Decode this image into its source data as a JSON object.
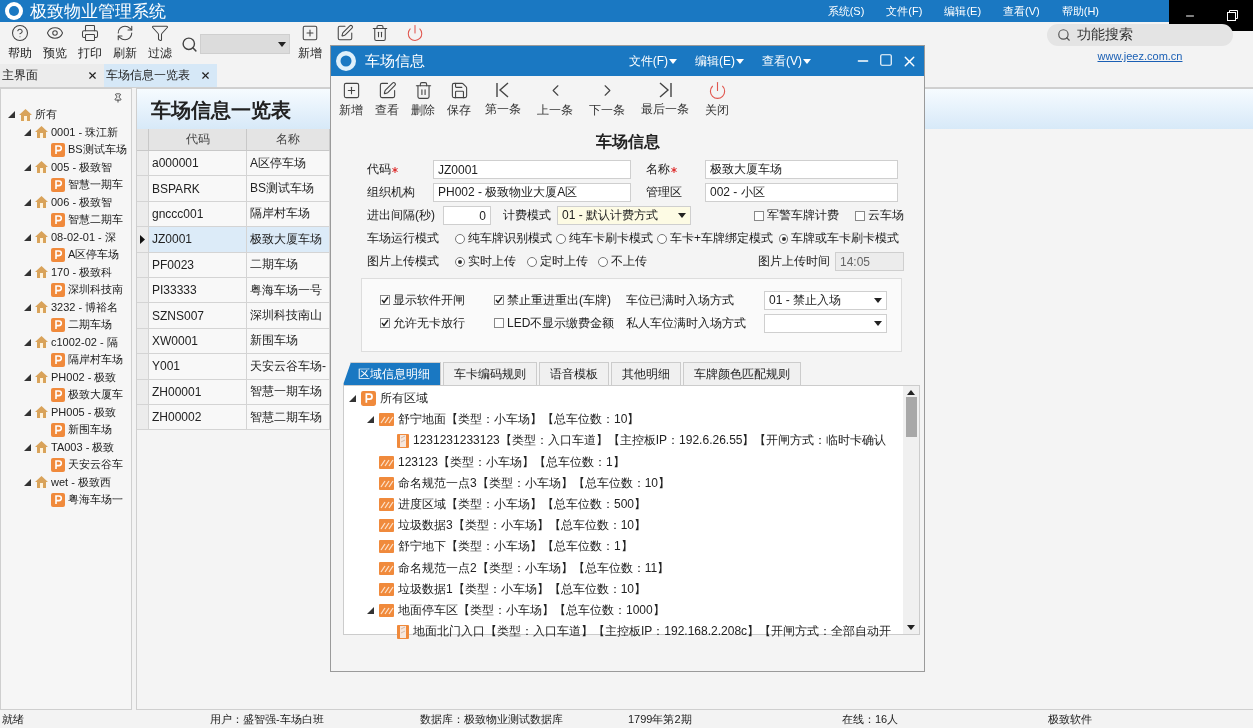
{
  "app": {
    "title": "极致物业管理系统",
    "menu": [
      "系统(S)",
      "文件(F)",
      "编辑(E)",
      "查看(V)",
      "帮助(H)"
    ]
  },
  "toolbar": {
    "left": [
      {
        "kind": "help",
        "label": "帮助"
      },
      {
        "kind": "preview",
        "label": "预览"
      },
      {
        "kind": "print",
        "label": "打印"
      },
      {
        "kind": "refresh",
        "label": "刷新"
      },
      {
        "kind": "filter",
        "label": "过滤"
      }
    ],
    "right": [
      {
        "kind": "add",
        "label": "新增"
      },
      {
        "kind": "edit"
      },
      {
        "kind": "delete"
      },
      {
        "kind": "power"
      }
    ]
  },
  "feature_search": {
    "placeholder": "功能搜索"
  },
  "website": "www.jeez.com.cn",
  "doc_tabs": [
    {
      "label": "主界面",
      "selected": false
    },
    {
      "label": "车场信息一览表",
      "selected": true
    }
  ],
  "org_tree": {
    "label": "所有",
    "expanded": true,
    "children": [
      {
        "label": "0001 - 珠江新",
        "expanded": true,
        "children": [
          {
            "label": "BS测试车场"
          }
        ]
      },
      {
        "label": "005 - 极致智",
        "expanded": true,
        "children": [
          {
            "label": "智慧一期车"
          }
        ]
      },
      {
        "label": "006 - 极致智",
        "expanded": true,
        "children": [
          {
            "label": "智慧二期车"
          }
        ]
      },
      {
        "label": "08-02-01 - 深",
        "expanded": true,
        "children": [
          {
            "label": "A区停车场"
          }
        ]
      },
      {
        "label": "170 - 极致科",
        "expanded": true,
        "children": [
          {
            "label": "深圳科技南"
          }
        ]
      },
      {
        "label": "3232 - 博裕名",
        "expanded": true,
        "children": [
          {
            "label": "二期车场"
          }
        ]
      },
      {
        "label": "c1002-02 - 隔",
        "expanded": true,
        "children": [
          {
            "label": "隔岸村车场"
          }
        ]
      },
      {
        "label": "PH002 - 极致",
        "expanded": true,
        "children": [
          {
            "label": "极致大厦车"
          }
        ]
      },
      {
        "label": "PH005 - 极致",
        "expanded": true,
        "children": [
          {
            "label": "新围车场"
          }
        ]
      },
      {
        "label": "TA003 - 极致",
        "expanded": true,
        "children": [
          {
            "label": "天安云谷车"
          }
        ]
      },
      {
        "label": "wet - 极致西",
        "expanded": true,
        "children": [
          {
            "label": "粤海车场一"
          }
        ]
      }
    ]
  },
  "list": {
    "title": "车场信息一览表",
    "columns": [
      "代码",
      "名称"
    ],
    "rows": [
      {
        "cells": [
          "a000001",
          "A区停车场"
        ],
        "selected": false
      },
      {
        "cells": [
          "BSPARK",
          "BS测试车场"
        ],
        "selected": false
      },
      {
        "cells": [
          "gnccc001",
          "隔岸村车场"
        ],
        "selected": false
      },
      {
        "cells": [
          "JZ0001",
          "极致大厦车场"
        ],
        "selected": true
      },
      {
        "cells": [
          "PF0023",
          "二期车场"
        ],
        "selected": false
      },
      {
        "cells": [
          "PI33333",
          "粤海车场一号"
        ],
        "selected": false
      },
      {
        "cells": [
          "SZNS007",
          "深圳科技南山"
        ],
        "selected": false
      },
      {
        "cells": [
          "XW0001",
          "新围车场"
        ],
        "selected": false
      },
      {
        "cells": [
          "Y001",
          "天安云谷车场-"
        ],
        "selected": false
      },
      {
        "cells": [
          "ZH00001",
          "智慧一期车场"
        ],
        "selected": false
      },
      {
        "cells": [
          "ZH00002",
          "智慧二期车场"
        ],
        "selected": false
      }
    ]
  },
  "dialog": {
    "title": "车场信息",
    "menu": [
      "文件(F)",
      "编辑(E)",
      "查看(V)"
    ],
    "toolbar": [
      {
        "kind": "add",
        "label": "新增"
      },
      {
        "kind": "edit",
        "label": "查看"
      },
      {
        "kind": "delete",
        "label": "删除"
      },
      {
        "kind": "save",
        "label": "保存"
      },
      {
        "kind": "first",
        "label": "第一条"
      },
      {
        "kind": "prev",
        "label": "上一条"
      },
      {
        "kind": "next",
        "label": "下一条"
      },
      {
        "kind": "last",
        "label": "最后一条"
      },
      {
        "kind": "close",
        "label": "关闭"
      }
    ],
    "form_title": "车场信息",
    "code": {
      "label": "代码",
      "required": true,
      "value": "JZ0001"
    },
    "name": {
      "label": "名称",
      "required": true,
      "value": "极致大厦车场"
    },
    "org": {
      "label": "组织机构",
      "required": false,
      "value": "PH002 - 极致物业大厦A区"
    },
    "area": {
      "label": "管理区",
      "required": false,
      "value": "002 - 小区"
    },
    "interval": {
      "label": "进出间隔(秒)",
      "value": "0"
    },
    "billing": {
      "label": "计费模式",
      "value": "01 - 默认计费方式"
    },
    "military_plate": {
      "label": "军警车牌计费",
      "checked": false
    },
    "cloud": {
      "label": "云车场",
      "checked": false
    },
    "run_mode": {
      "label": "车场运行模式",
      "options": [
        {
          "label": "纯车牌识别模式",
          "selected": false
        },
        {
          "label": "纯车卡刷卡模式",
          "selected": false
        },
        {
          "label": "车卡+车牌绑定模式",
          "selected": false
        },
        {
          "label": "车牌或车卡刷卡模式",
          "selected": true
        }
      ]
    },
    "upload_mode": {
      "label": "图片上传模式",
      "options": [
        {
          "label": "实时上传",
          "selected": true
        },
        {
          "label": "定时上传",
          "selected": false
        },
        {
          "label": "不上传",
          "selected": false
        }
      ]
    },
    "upload_time": {
      "label": "图片上传时间",
      "value": "14:05",
      "disabled": true
    },
    "options": [
      {
        "label": "显示软件开闸",
        "checked": true
      },
      {
        "label": "禁止重进重出(车牌)",
        "checked": true
      },
      {
        "label": "允许无卡放行",
        "checked": true
      },
      {
        "label": "LED不显示缴费金额",
        "checked": false
      }
    ],
    "full_entry": {
      "label": "车位已满时入场方式",
      "value": "01 - 禁止入场"
    },
    "private_full_entry": {
      "label": "私人车位满时入场方式"
    },
    "tabs": [
      {
        "label": "区域信息明细",
        "selected": true
      },
      {
        "label": "车卡编码规则",
        "selected": false
      },
      {
        "label": "语音模板",
        "selected": false
      },
      {
        "label": "其他明细",
        "selected": false
      },
      {
        "label": "车牌颜色匹配规则",
        "selected": false
      }
    ],
    "zone_tree": {
      "kind": "root",
      "label": "所有区域",
      "expanded": true,
      "children": [
        {
          "kind": "zone",
          "label": "舒宁地面【类型：小车场】【总车位数：10】",
          "expanded": true,
          "children": [
            {
              "kind": "lane",
              "label": "1231231233123【类型：入口车道】【主控板IP：192.6.26.55】【开闸方式：临时卡确认"
            }
          ]
        },
        {
          "kind": "zone",
          "label": "123123【类型：小车场】【总车位数：1】"
        },
        {
          "kind": "zone",
          "label": "命名规范一点3【类型：小车场】【总车位数：10】"
        },
        {
          "kind": "zone",
          "label": "进度区域【类型：小车场】【总车位数：500】"
        },
        {
          "kind": "zone",
          "label": "垃圾数据3【类型：小车场】【总车位数：10】"
        },
        {
          "kind": "zone",
          "label": "舒宁地下【类型：小车场】【总车位数：1】"
        },
        {
          "kind": "zone",
          "label": "命名规范一点2【类型：小车场】【总车位数：11】"
        },
        {
          "kind": "zone",
          "label": "垃圾数据1【类型：小车场】【总车位数：10】"
        },
        {
          "kind": "zone",
          "label": "地面停车区【类型：小车场】【总车位数：1000】",
          "expanded": true,
          "children": [
            {
              "kind": "lane",
              "label": "地面北门入口【类型：入口车道】【主控板IP：192.168.2.208c】【开闸方式：全部自动开"
            }
          ]
        }
      ]
    }
  },
  "status_bar": [
    "就绪",
    "用户：盛智强-车场白班",
    "数据库：极致物业测试数据库",
    "1799年第2期",
    "在线：16人",
    "极致软件"
  ]
}
